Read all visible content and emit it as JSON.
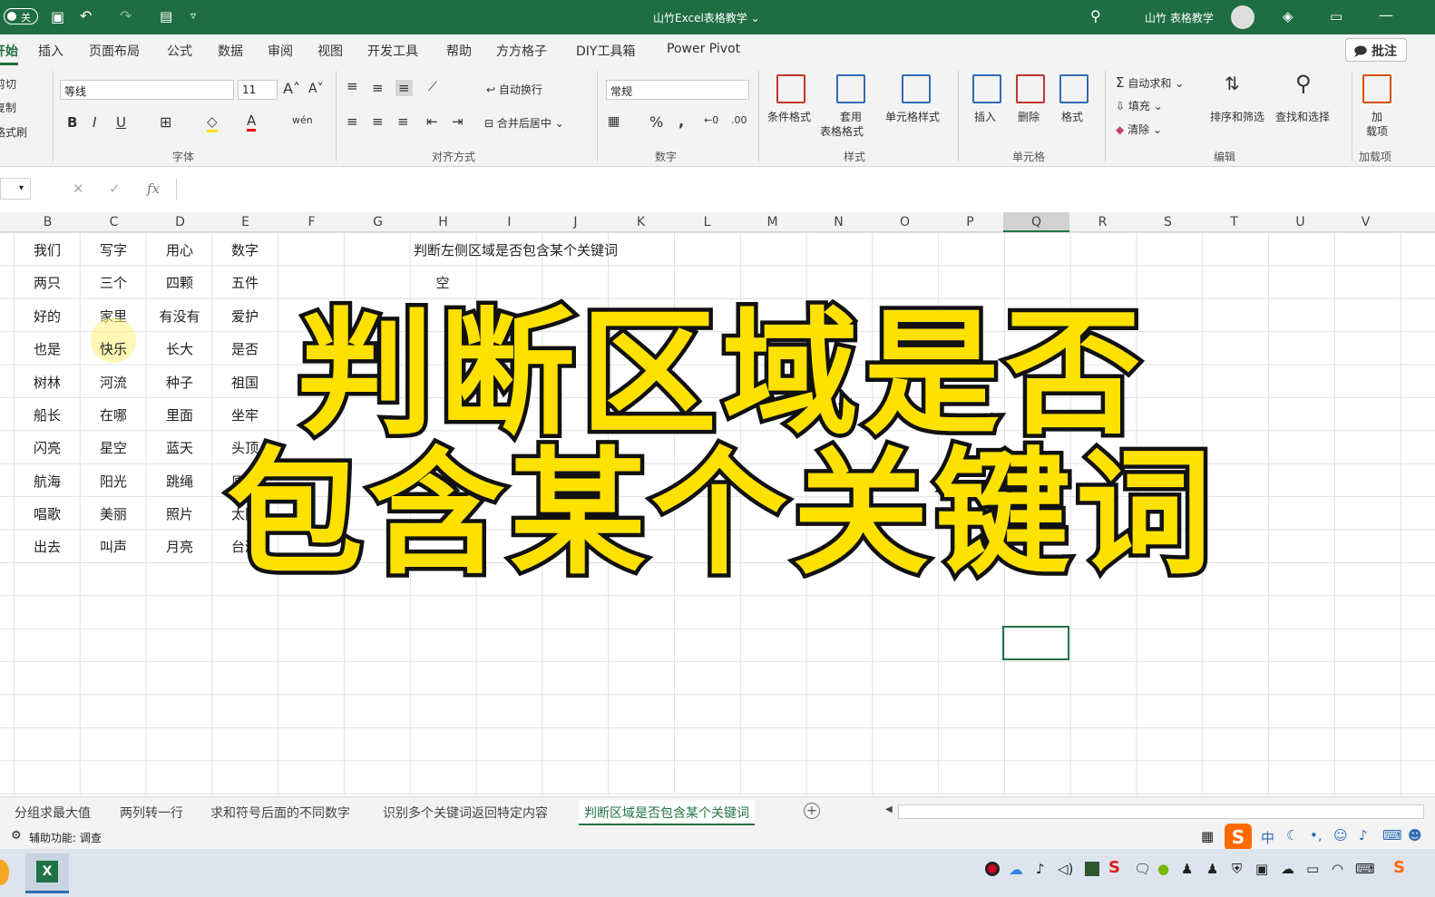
{
  "titlebar": {
    "autosave": "关",
    "title": "山竹Excel表格教学 ⌄",
    "user": "山竹 表格教学"
  },
  "tabs": [
    "开始",
    "插入",
    "页面布局",
    "公式",
    "数据",
    "审阅",
    "视图",
    "开发工具",
    "帮助",
    "方方格子",
    "DIY工具箱",
    "Power Pivot"
  ],
  "comment_button": "批注",
  "ribbon": {
    "clipboard": [
      "剪切",
      "复制",
      "格式刷"
    ],
    "font_name": "等线",
    "font_size": "11",
    "font_group": "字体",
    "wrap": "自动换行",
    "merge": "合并后居中",
    "align_group": "对齐方式",
    "number_format": "常规",
    "number_group": "数字",
    "cond_format": "条件格式",
    "table_format_1": "套用",
    "table_format_2": "表格格式",
    "cell_style": "单元格样式",
    "style_group": "样式",
    "insert": "插入",
    "delete": "删除",
    "format": "格式",
    "cells_group": "单元格",
    "autosum": "自动求和",
    "fill": "填充",
    "clear": "清除",
    "sort_filter": "排序和筛选",
    "find_select": "查找和选择",
    "edit_group": "编辑",
    "addins_1": "加",
    "addins_2": "载项",
    "addins_group": "加载项"
  },
  "formula": {
    "fx": "fx",
    "cancel": "✕",
    "confirm": "✓"
  },
  "columns": [
    "B",
    "C",
    "D",
    "E",
    "F",
    "G",
    "H",
    "I",
    "J",
    "K",
    "L",
    "M",
    "N",
    "O",
    "P",
    "Q",
    "R",
    "S",
    "T",
    "U",
    "V"
  ],
  "table": [
    [
      "我们",
      "写字",
      "用心",
      "数字"
    ],
    [
      "两只",
      "三个",
      "四颗",
      "五件"
    ],
    [
      "好的",
      "家里",
      "有没有",
      "爱护"
    ],
    [
      "也是",
      "快乐",
      "长大",
      "是否"
    ],
    [
      "树林",
      "河流",
      "种子",
      "祖国"
    ],
    [
      "船长",
      "在哪",
      "里面",
      "坐牢"
    ],
    [
      "闪亮",
      "星空",
      "蓝天",
      "头顶"
    ],
    [
      "航海",
      "阳光",
      "跳绳",
      "原来"
    ],
    [
      "唱歌",
      "美丽",
      "照片",
      "太阳"
    ],
    [
      "出去",
      "叫声",
      "月亮",
      "台湾"
    ]
  ],
  "h1_text": "判断左侧区域是否包含某个关键词",
  "h2_text": "空",
  "overlay": {
    "line1": "判断区域是否",
    "line2": "包含某个关键词"
  },
  "sheets": [
    "分组求最大值",
    "两列转一行",
    "求和符号后面的不同数字",
    "识别多个关键词返回特定内容",
    "判断区域是否包含某个关键词"
  ],
  "status": "辅助功能: 调查",
  "ime": "中"
}
